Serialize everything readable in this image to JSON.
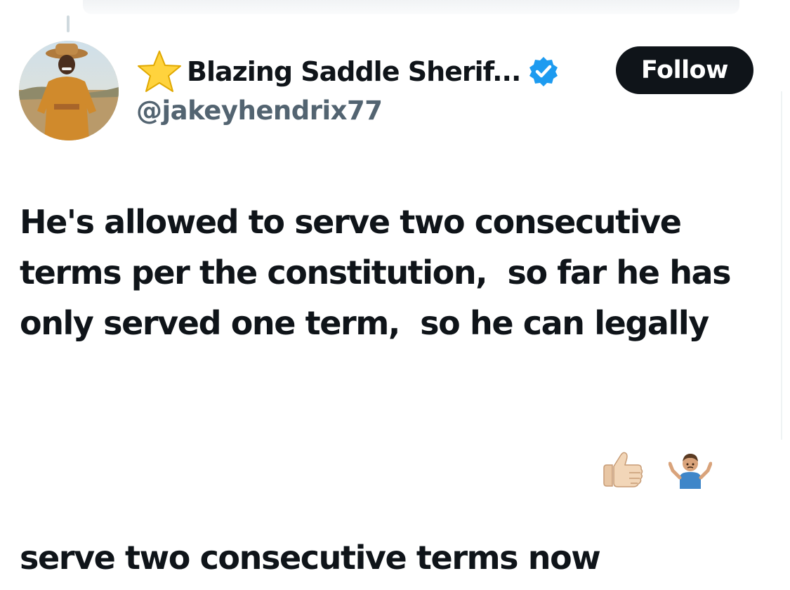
{
  "post": {
    "author": {
      "name_emoji_icon": "star-icon",
      "display_name": "Blazing Saddle Sherif...",
      "verified": true,
      "verified_icon": "verified-badge-icon",
      "handle": "@jakeyhendrix77"
    },
    "follow_label": "Follow",
    "text_lines": [
      "He's allowed to serve two consecutive",
      "terms per the constitution,  so far he has",
      "only served one term,  so he can legally",
      "serve two consecutive terms now"
    ],
    "trailing_emojis": [
      "thumbs-up-emoji",
      "person-shrugging-emoji"
    ]
  },
  "colors": {
    "text_primary": "#0f1419",
    "text_secondary": "#536471",
    "verified_blue": "#1d9bf0",
    "follow_bg": "#0f1419",
    "follow_text": "#ffffff"
  }
}
